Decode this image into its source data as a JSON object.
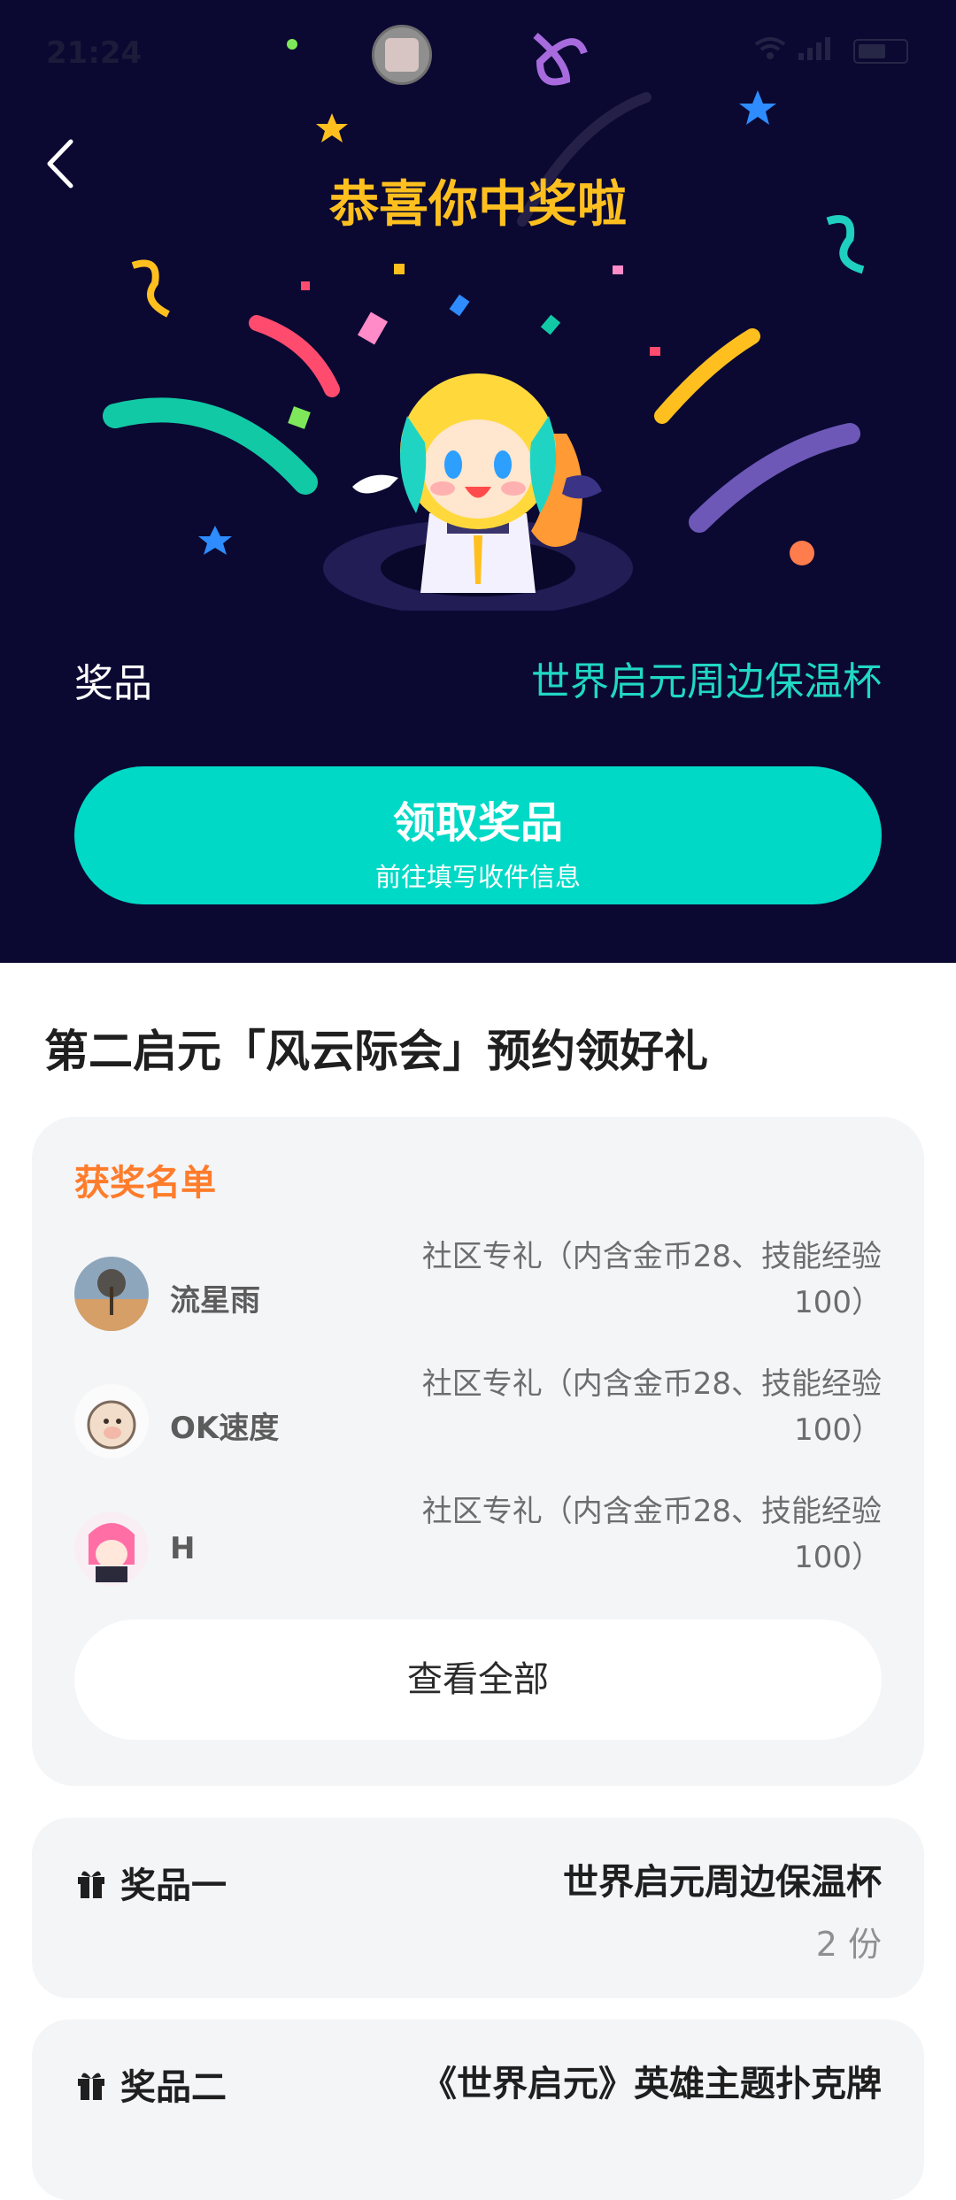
{
  "status_bar": {
    "time": "21:24",
    "wifi_icon": "wifi-icon",
    "signal_icon": "signal-icon",
    "battery_icon": "battery-icon"
  },
  "header": {
    "back_icon": "back-icon",
    "title": "恭喜你中奖啦"
  },
  "prize_result": {
    "label": "奖品",
    "name": "世界启元周边保温杯"
  },
  "claim_button": {
    "label": "领取奖品",
    "sublabel": "前往填写收件信息"
  },
  "event": {
    "title": "第二启元「风云际会」预约领好礼"
  },
  "winners": {
    "title": "获奖名单",
    "items": [
      {
        "name": "流星雨",
        "reward": "社区专礼（内含金币28、技能经验100）"
      },
      {
        "name": "OK速度",
        "reward": "社区专礼（内含金币28、技能经验100）"
      },
      {
        "name": "H",
        "reward": "社区专礼（内含金币28、技能经验100）"
      }
    ],
    "view_all": "查看全部"
  },
  "prizes": [
    {
      "label": "奖品一",
      "name": "世界启元周边保温杯",
      "count": "2 份",
      "icon": "gift-icon"
    },
    {
      "label": "奖品二",
      "name": "《世界启元》英雄主题扑克牌",
      "icon": "gift-icon"
    }
  ],
  "colors": {
    "hero_background": "#0b0932",
    "headline": "#ffc01f",
    "accent": "#00d9c6",
    "winners_title": "#ff7c2b"
  }
}
